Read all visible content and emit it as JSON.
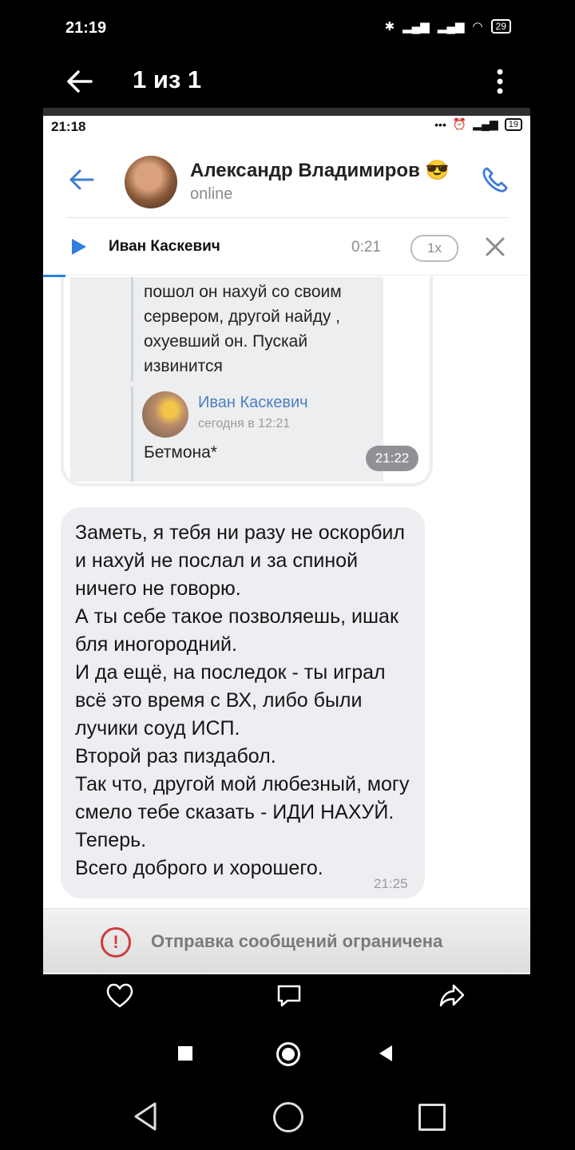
{
  "outer_status": {
    "time": "21:19",
    "battery": "29"
  },
  "viewer": {
    "counter": "1 из 1"
  },
  "screenshot": {
    "status": {
      "time": "21:18",
      "battery": "19"
    },
    "header": {
      "name": "Александр Владимиров 😎",
      "status": "online"
    },
    "player": {
      "name": "Иван Каскевич",
      "time": "0:21",
      "speed": "1x"
    },
    "quoted": {
      "text": "пошол он нахуй со своим сервером, другой найду , охуевший он. Пускай извинится",
      "author": "Иван Каскевич",
      "date": "сегодня в 12:21",
      "reply": "Бетмона*",
      "time": "21:22"
    },
    "message": {
      "text": "Заметь, я тебя ни разу не оскорбил и нахуй не послал и за спиной ничего не говорю.\nА ты себе такое позволяешь, ишак бля иногородний.\nИ да ещё, на последок - ты играл всё это время с ВХ, либо были лучики соуд ИСП.\nВторой раз пиздабол.\nТак что, другой мой любезный, могу смело тебе сказать - ИДИ НАХУЙ. Теперь.\nВсего доброго и хорошего.",
      "time": "21:25"
    },
    "restriction": {
      "icon": "!",
      "text": "Отправка сообщений ограничена"
    }
  },
  "colors": {
    "accent": "#2f7ee0",
    "warning": "#d13b3b",
    "bubble": "#eceef1"
  }
}
